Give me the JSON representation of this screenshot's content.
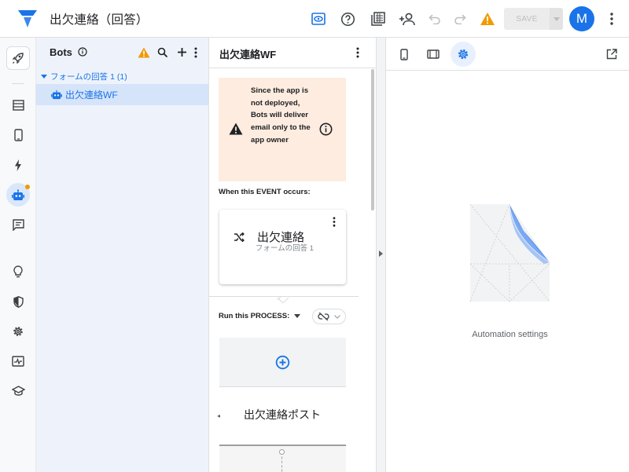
{
  "app": {
    "title": "出欠連絡（回答）",
    "accent_color": "#1a73e8",
    "warning_color": "#f29900"
  },
  "topbar": {
    "icons": [
      "preview-eye-icon",
      "help-icon",
      "gallery-icon",
      "share-user-icon",
      "undo-icon",
      "redo-icon",
      "warning-icon"
    ],
    "save_label": "SAVE",
    "avatar_letter": "M"
  },
  "leftnav": {
    "items": [
      "rocket-icon",
      "data-table-icon",
      "mobile-icon",
      "bolt-icon",
      "bot-icon",
      "chat-icon",
      "lightbulb-icon",
      "shield-icon",
      "gear-icon",
      "monitor-icon",
      "school-icon"
    ],
    "active": "bot-icon"
  },
  "bots": {
    "title": "Bots",
    "group_label": "フォームの回答 1 (1)",
    "items": [
      {
        "label": "出欠連絡WF"
      }
    ]
  },
  "workflow": {
    "title": "出欠連絡WF",
    "warning_text": "Since the app is not deployed, Bots will deliver email only to the app owner",
    "event_label": "When this EVENT occurs:",
    "event_name": "出欠連絡",
    "event_source": "フォームの回答 1",
    "process_label": "Run this PROCESS:",
    "step_name": "出欠連絡ポスト"
  },
  "settings": {
    "tabs": [
      "mobile-preview-icon",
      "tablet-preview-icon",
      "settings-icon"
    ],
    "active_tab": "settings-icon",
    "caption": "Automation settings"
  }
}
